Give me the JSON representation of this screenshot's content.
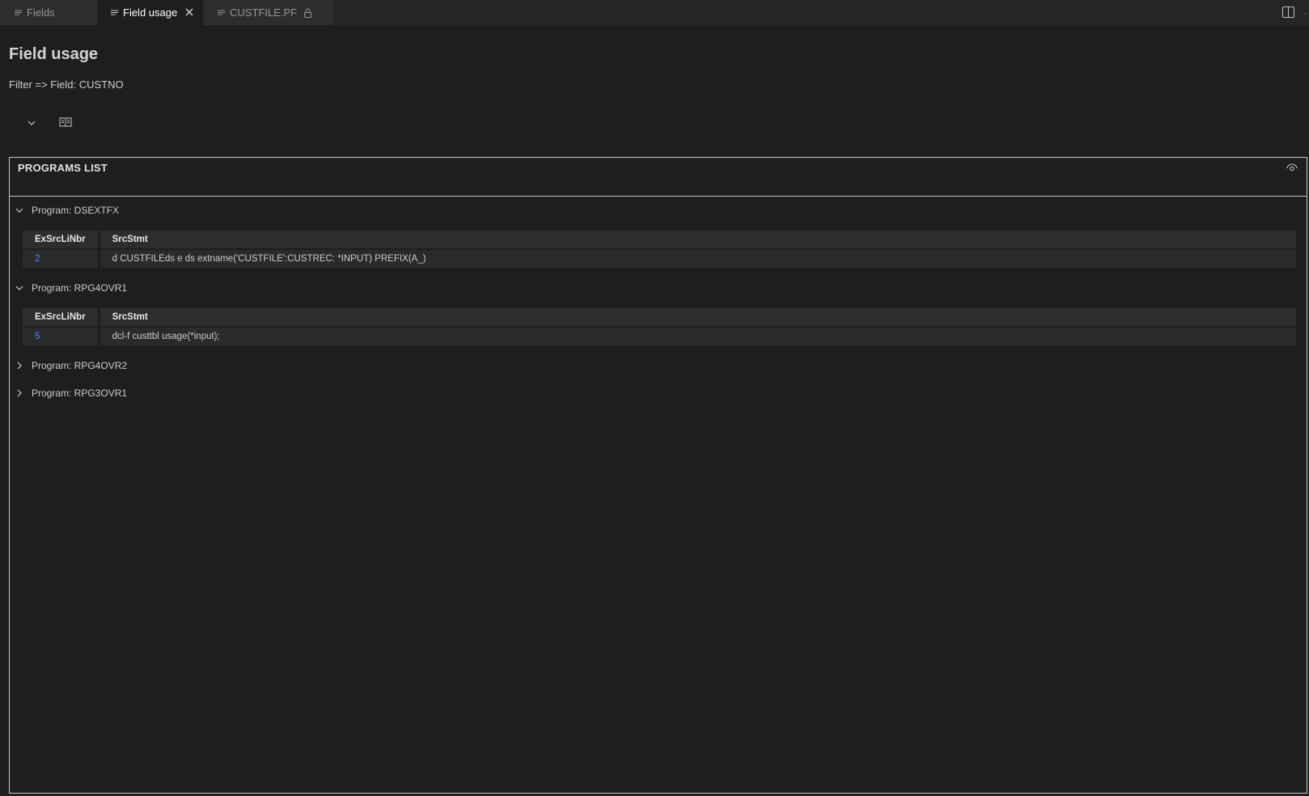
{
  "tabs": [
    {
      "label": "Fields",
      "icon": "document-icon",
      "active": false
    },
    {
      "label": "Field usage",
      "icon": "document-icon",
      "active": true
    },
    {
      "label": "CUSTFILE.PF",
      "icon": "document-icon",
      "active": false,
      "locked": true
    }
  ],
  "page": {
    "title": "Field usage",
    "filter": "Filter => Field: CUSTNO"
  },
  "toolbar": {
    "collapse_icon": "chevron-down-icon",
    "view_icon": "book-icon"
  },
  "panel": {
    "title": "PROGRAMS LIST",
    "programs": [
      {
        "label": "Program: DSEXTFX",
        "expanded": true,
        "columns": [
          "ExSrcLiNbr",
          "SrcStmt"
        ],
        "rows": [
          {
            "line": "2",
            "stmt": "d CUSTFILEds e ds extname('CUSTFILE':CUSTREC: *INPUT) PREFIX(A_)"
          }
        ]
      },
      {
        "label": "Program: RPG4OVR1",
        "expanded": true,
        "columns": [
          "ExSrcLiNbr",
          "SrcStmt"
        ],
        "rows": [
          {
            "line": "5",
            "stmt": "dcl-f custtbl usage(*input);"
          }
        ]
      },
      {
        "label": "Program: RPG4OVR2",
        "expanded": false
      },
      {
        "label": "Program: RPG3OVR1",
        "expanded": false
      }
    ]
  },
  "colors": {
    "background": "#1e1e1e",
    "tabbar": "#252526",
    "link": "#3794ff",
    "border": "#c8c8c8"
  }
}
